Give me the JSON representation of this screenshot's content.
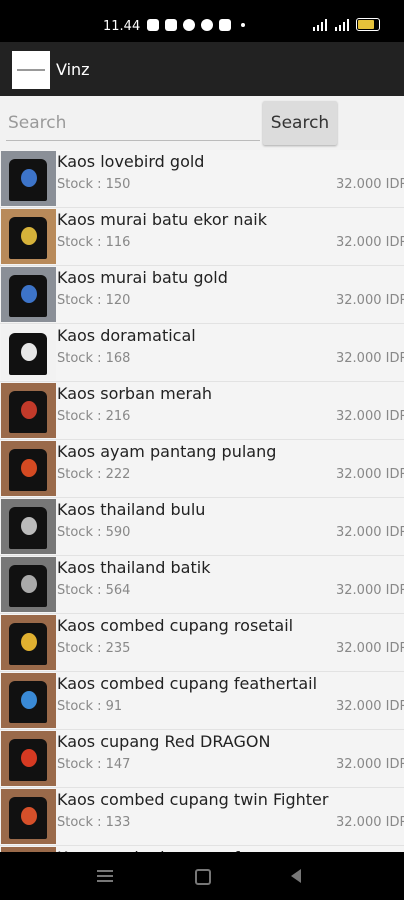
{
  "status": {
    "time": "11.44",
    "colors": {
      "battery": "#e6c23a"
    },
    "icons": [
      "instagram-icon",
      "shop-icon",
      "app-icon",
      "facebook-icon",
      "message-icon"
    ]
  },
  "app": {
    "title": "Vinz"
  },
  "search": {
    "placeholder": "Search",
    "button_label": "Search"
  },
  "products": [
    {
      "name": "Kaos lovebird gold",
      "stock": "Stock : 150",
      "price": "32.000 IDR",
      "thumb_bg": "#8a8f97",
      "print": "#3d74c9"
    },
    {
      "name": "Kaos murai batu ekor naik",
      "stock": "Stock : 116",
      "price": "32.000 IDR",
      "thumb_bg": "#b88a5a",
      "print": "#d6b23a"
    },
    {
      "name": "Kaos murai batu gold",
      "stock": "Stock : 120",
      "price": "32.000 IDR",
      "thumb_bg": "#8a8f97",
      "print": "#3d74c9"
    },
    {
      "name": "Kaos doramatical",
      "stock": "Stock : 168",
      "price": "32.000 IDR",
      "thumb_bg": "#f2f2f2",
      "print": "#e8e8e8"
    },
    {
      "name": "Kaos sorban merah",
      "stock": "Stock : 216",
      "price": "32.000 IDR",
      "thumb_bg": "#9a6a4a",
      "print": "#c23a2a"
    },
    {
      "name": "Kaos ayam pantang pulang",
      "stock": "Stock : 222",
      "price": "32.000 IDR",
      "thumb_bg": "#9a6a4a",
      "print": "#d44a22"
    },
    {
      "name": "Kaos thailand bulu",
      "stock": "Stock : 590",
      "price": "32.000 IDR",
      "thumb_bg": "#777",
      "print": "#bbbbbb"
    },
    {
      "name": "Kaos thailand batik",
      "stock": "Stock : 564",
      "price": "32.000 IDR",
      "thumb_bg": "#777",
      "print": "#aaaaaa"
    },
    {
      "name": "Kaos combed cupang rosetail",
      "stock": "Stock : 235",
      "price": "32.000 IDR",
      "thumb_bg": "#9a6a4a",
      "print": "#e0b030"
    },
    {
      "name": "Kaos combed cupang feathertail",
      "stock": "Stock : 91",
      "price": "32.000 IDR",
      "thumb_bg": "#9a6a4a",
      "print": "#3a8ad6"
    },
    {
      "name": "Kaos cupang Red DRAGON",
      "stock": "Stock : 147",
      "price": "32.000 IDR",
      "thumb_bg": "#9a6a4a",
      "print": "#d63a22"
    },
    {
      "name": "Kaos combed cupang twin Fighter",
      "stock": "Stock : 133",
      "price": "32.000 IDR",
      "thumb_bg": "#9a6a4a",
      "print": "#d6502a"
    },
    {
      "name": "Kaos combed cupang fancy",
      "stock": "",
      "price": "",
      "thumb_bg": "#9a6a4a",
      "print": "#c05a2a"
    }
  ]
}
